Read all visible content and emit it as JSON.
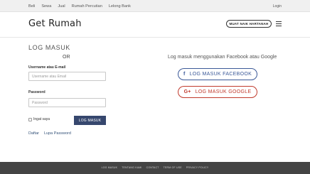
{
  "topnav": {
    "items": [
      "Beli",
      "Sewa",
      "Jual",
      "Rumah Percutian",
      "Lelong Bank"
    ],
    "login": "Login"
  },
  "header": {
    "logo": "Get Rumah",
    "cta": "MUAT NAIK HARTANAH",
    "menu_icon": "hamburger-menu-icon"
  },
  "login_form": {
    "title": "LOG MASUK",
    "or": "OR",
    "username_label": "Username atau E-mail",
    "username_placeholder": "Username atau Email",
    "password_label": "Password",
    "password_placeholder": "Password",
    "remember_label": "Ingat saya",
    "submit": "LOG MASUK",
    "register_link": "Daftar",
    "forgot_link": "Lupa Password"
  },
  "social": {
    "prompt": "Log masuk menggunakan Facebook atau Google",
    "facebook_label": "LOG MASUK FACEBOOK",
    "facebook_icon": "f",
    "google_label": "LOG MASUK GOOGLE",
    "google_icon": "G+",
    "facebook_color": "#3b5998",
    "google_color": "#c0392b"
  },
  "footer": {
    "links": [
      "LOG MASUK",
      "TENTANG KAMI",
      "CONTACT",
      "TERM OF USE",
      "PRIVACY POLICY"
    ]
  },
  "colors": {
    "primary_button": "#36476e",
    "footer_bg": "#444444"
  }
}
